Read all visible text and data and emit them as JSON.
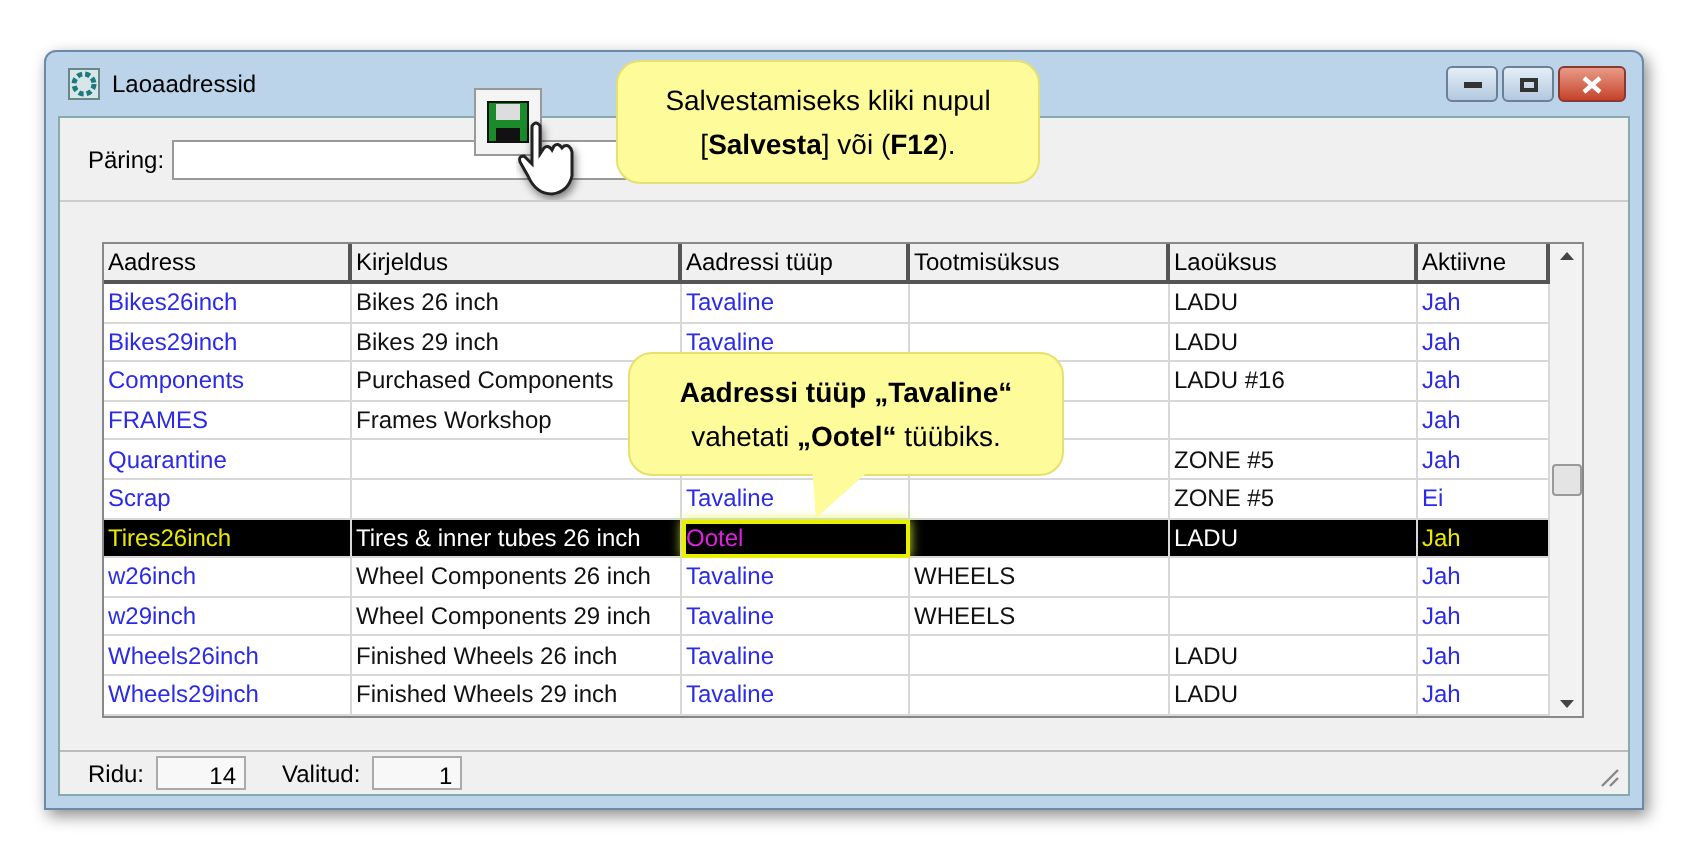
{
  "window": {
    "title": "Laoaadressid"
  },
  "query": {
    "label": "Päring:"
  },
  "callouts": [
    {
      "text": "Salvestamiseks kliki nupul [**Salvesta**] või (**F12**)."
    },
    {
      "text": "**Aadressi tüüp „Tavaline“** vahetati **„Ootel“** tüübiks."
    }
  ],
  "table": {
    "columns": [
      "Aadress",
      "Kirjeldus",
      "Aadressi tüüp",
      "Tootmisüksus",
      "Laoüksus",
      "Aktiivne"
    ],
    "rows": [
      {
        "address": "Bikes26inch",
        "description": "Bikes 26 inch",
        "type": "Tavaline",
        "warehouse_unit": "LADU",
        "active": "Jah",
        "selected": false
      },
      {
        "address": "Bikes29inch",
        "description": "Bikes 29 inch",
        "type": "Tavaline",
        "warehouse_unit": "LADU",
        "active": "Jah",
        "selected": false
      },
      {
        "address": "Components",
        "description": "Purchased Components",
        "warehouse_unit": "LADU #16",
        "active": "Jah",
        "selected": false
      },
      {
        "address": "FRAMES",
        "description": "Frames Workshop",
        "active": "Jah",
        "selected": false
      },
      {
        "address": "Quarantine",
        "warehouse_unit": "ZONE #5",
        "active": "Jah",
        "selected": false
      },
      {
        "address": "Scrap",
        "type": "Tavaline",
        "warehouse_unit": "ZONE #5",
        "active": "Ei",
        "selected": false
      },
      {
        "address": "Tires26inch",
        "description": "Tires & inner tubes 26 inch",
        "type": "Ootel",
        "type_highlighted": true,
        "warehouse_unit": "LADU",
        "active": "Jah",
        "selected": true
      },
      {
        "address": "w26inch",
        "description": "Wheel Components 26 inch",
        "type": "Tavaline",
        "production_unit": "WHEELS",
        "active": "Jah",
        "selected": false
      },
      {
        "address": "w29inch",
        "description": "Wheel Components 29 inch",
        "type": "Tavaline",
        "production_unit": "WHEELS",
        "active": "Jah",
        "selected": false
      },
      {
        "address": "Wheels26inch",
        "description": "Finished Wheels 26 inch",
        "type": "Tavaline",
        "warehouse_unit": "LADU",
        "active": "Jah",
        "selected": false
      },
      {
        "address": "Wheels29inch",
        "description": "Finished Wheels 29 inch",
        "type": "Tavaline",
        "warehouse_unit": "LADU",
        "active": "Jah",
        "selected": false
      }
    ]
  },
  "status_bar": {
    "rows_label": "Ridu:",
    "rows_value": "14",
    "selected_label": "Valitud:",
    "selected_value": "1"
  }
}
